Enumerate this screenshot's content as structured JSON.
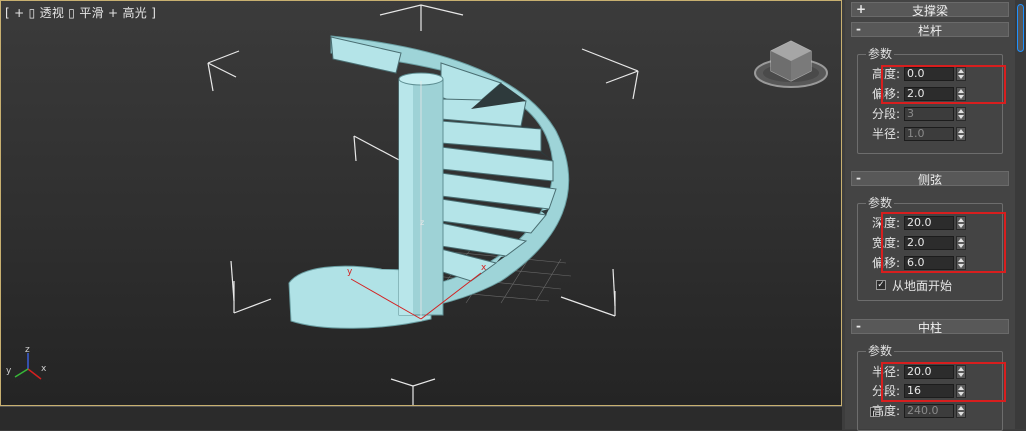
{
  "viewport": {
    "label": "[ + ▯ 透视 ▯ 平滑 + 高光 ]",
    "axis_labels": {
      "x": "x",
      "y": "y",
      "z": "z"
    }
  },
  "panel": {
    "support_beam": {
      "symbol": "+",
      "title": "支撑梁"
    },
    "railing": {
      "symbol": "-",
      "title": "栏杆",
      "group": "参数",
      "params": [
        {
          "label": "高度:",
          "value": "0.0"
        },
        {
          "label": "偏移:",
          "value": "2.0"
        },
        {
          "label": "分段:",
          "value": "3"
        },
        {
          "label": "半径:",
          "value": "1.0"
        }
      ]
    },
    "stringer": {
      "symbol": "-",
      "title": "侧弦",
      "group": "参数",
      "params": [
        {
          "label": "深度:",
          "value": "20.0"
        },
        {
          "label": "宽度:",
          "value": "2.0"
        },
        {
          "label": "偏移:",
          "value": "6.0"
        }
      ],
      "checkbox_label": "从地面开始",
      "checkbox_checked": true
    },
    "center_pole": {
      "symbol": "-",
      "title": "中柱",
      "group": "参数",
      "params": [
        {
          "label": "半径:",
          "value": "20.0"
        },
        {
          "label": "分段:",
          "value": "16"
        },
        {
          "label": "高度:",
          "value": "240.0"
        }
      ],
      "height_checkbox_checked": false
    }
  },
  "colors": {
    "viewport_border": "#c8b070",
    "stair_fill": "#a9dde1",
    "highlight_box": "#d81e1e",
    "scroll_accent": "#1e90ff"
  }
}
